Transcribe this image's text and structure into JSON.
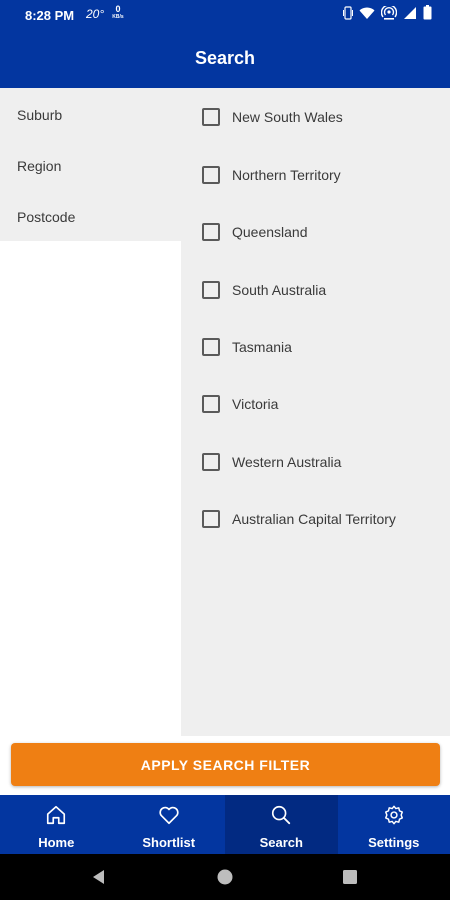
{
  "status_bar": {
    "time": "8:28 PM",
    "temperature": "20°",
    "data_rate": "0",
    "data_unit": "KB/s",
    "icons": [
      "vibrate-icon",
      "wifi-icon",
      "hotspot-icon",
      "signal-icon",
      "battery-icon"
    ]
  },
  "app_bar": {
    "title": "Search"
  },
  "left_menu": {
    "items": [
      {
        "label": "Suburb"
      },
      {
        "label": "Region"
      },
      {
        "label": "Postcode"
      }
    ]
  },
  "states": {
    "items": [
      {
        "label": "New South Wales",
        "checked": false
      },
      {
        "label": "Northern Territory",
        "checked": false
      },
      {
        "label": "Queensland",
        "checked": false
      },
      {
        "label": "South Australia",
        "checked": false
      },
      {
        "label": "Tasmania",
        "checked": false
      },
      {
        "label": "Victoria",
        "checked": false
      },
      {
        "label": "Western Australia",
        "checked": false
      },
      {
        "label": "Australian Capital Territory",
        "checked": false
      }
    ]
  },
  "apply_button": {
    "label": "APPLY SEARCH FILTER"
  },
  "bottom_nav": {
    "active": "Search",
    "items": [
      {
        "label": "Home",
        "icon": "home-icon"
      },
      {
        "label": "Shortlist",
        "icon": "heart-icon"
      },
      {
        "label": "Search",
        "icon": "search-icon"
      },
      {
        "label": "Settings",
        "icon": "gear-icon"
      }
    ]
  },
  "colors": {
    "primary": "#0336a0",
    "accent": "#ef7f13",
    "panel": "#efefef"
  }
}
